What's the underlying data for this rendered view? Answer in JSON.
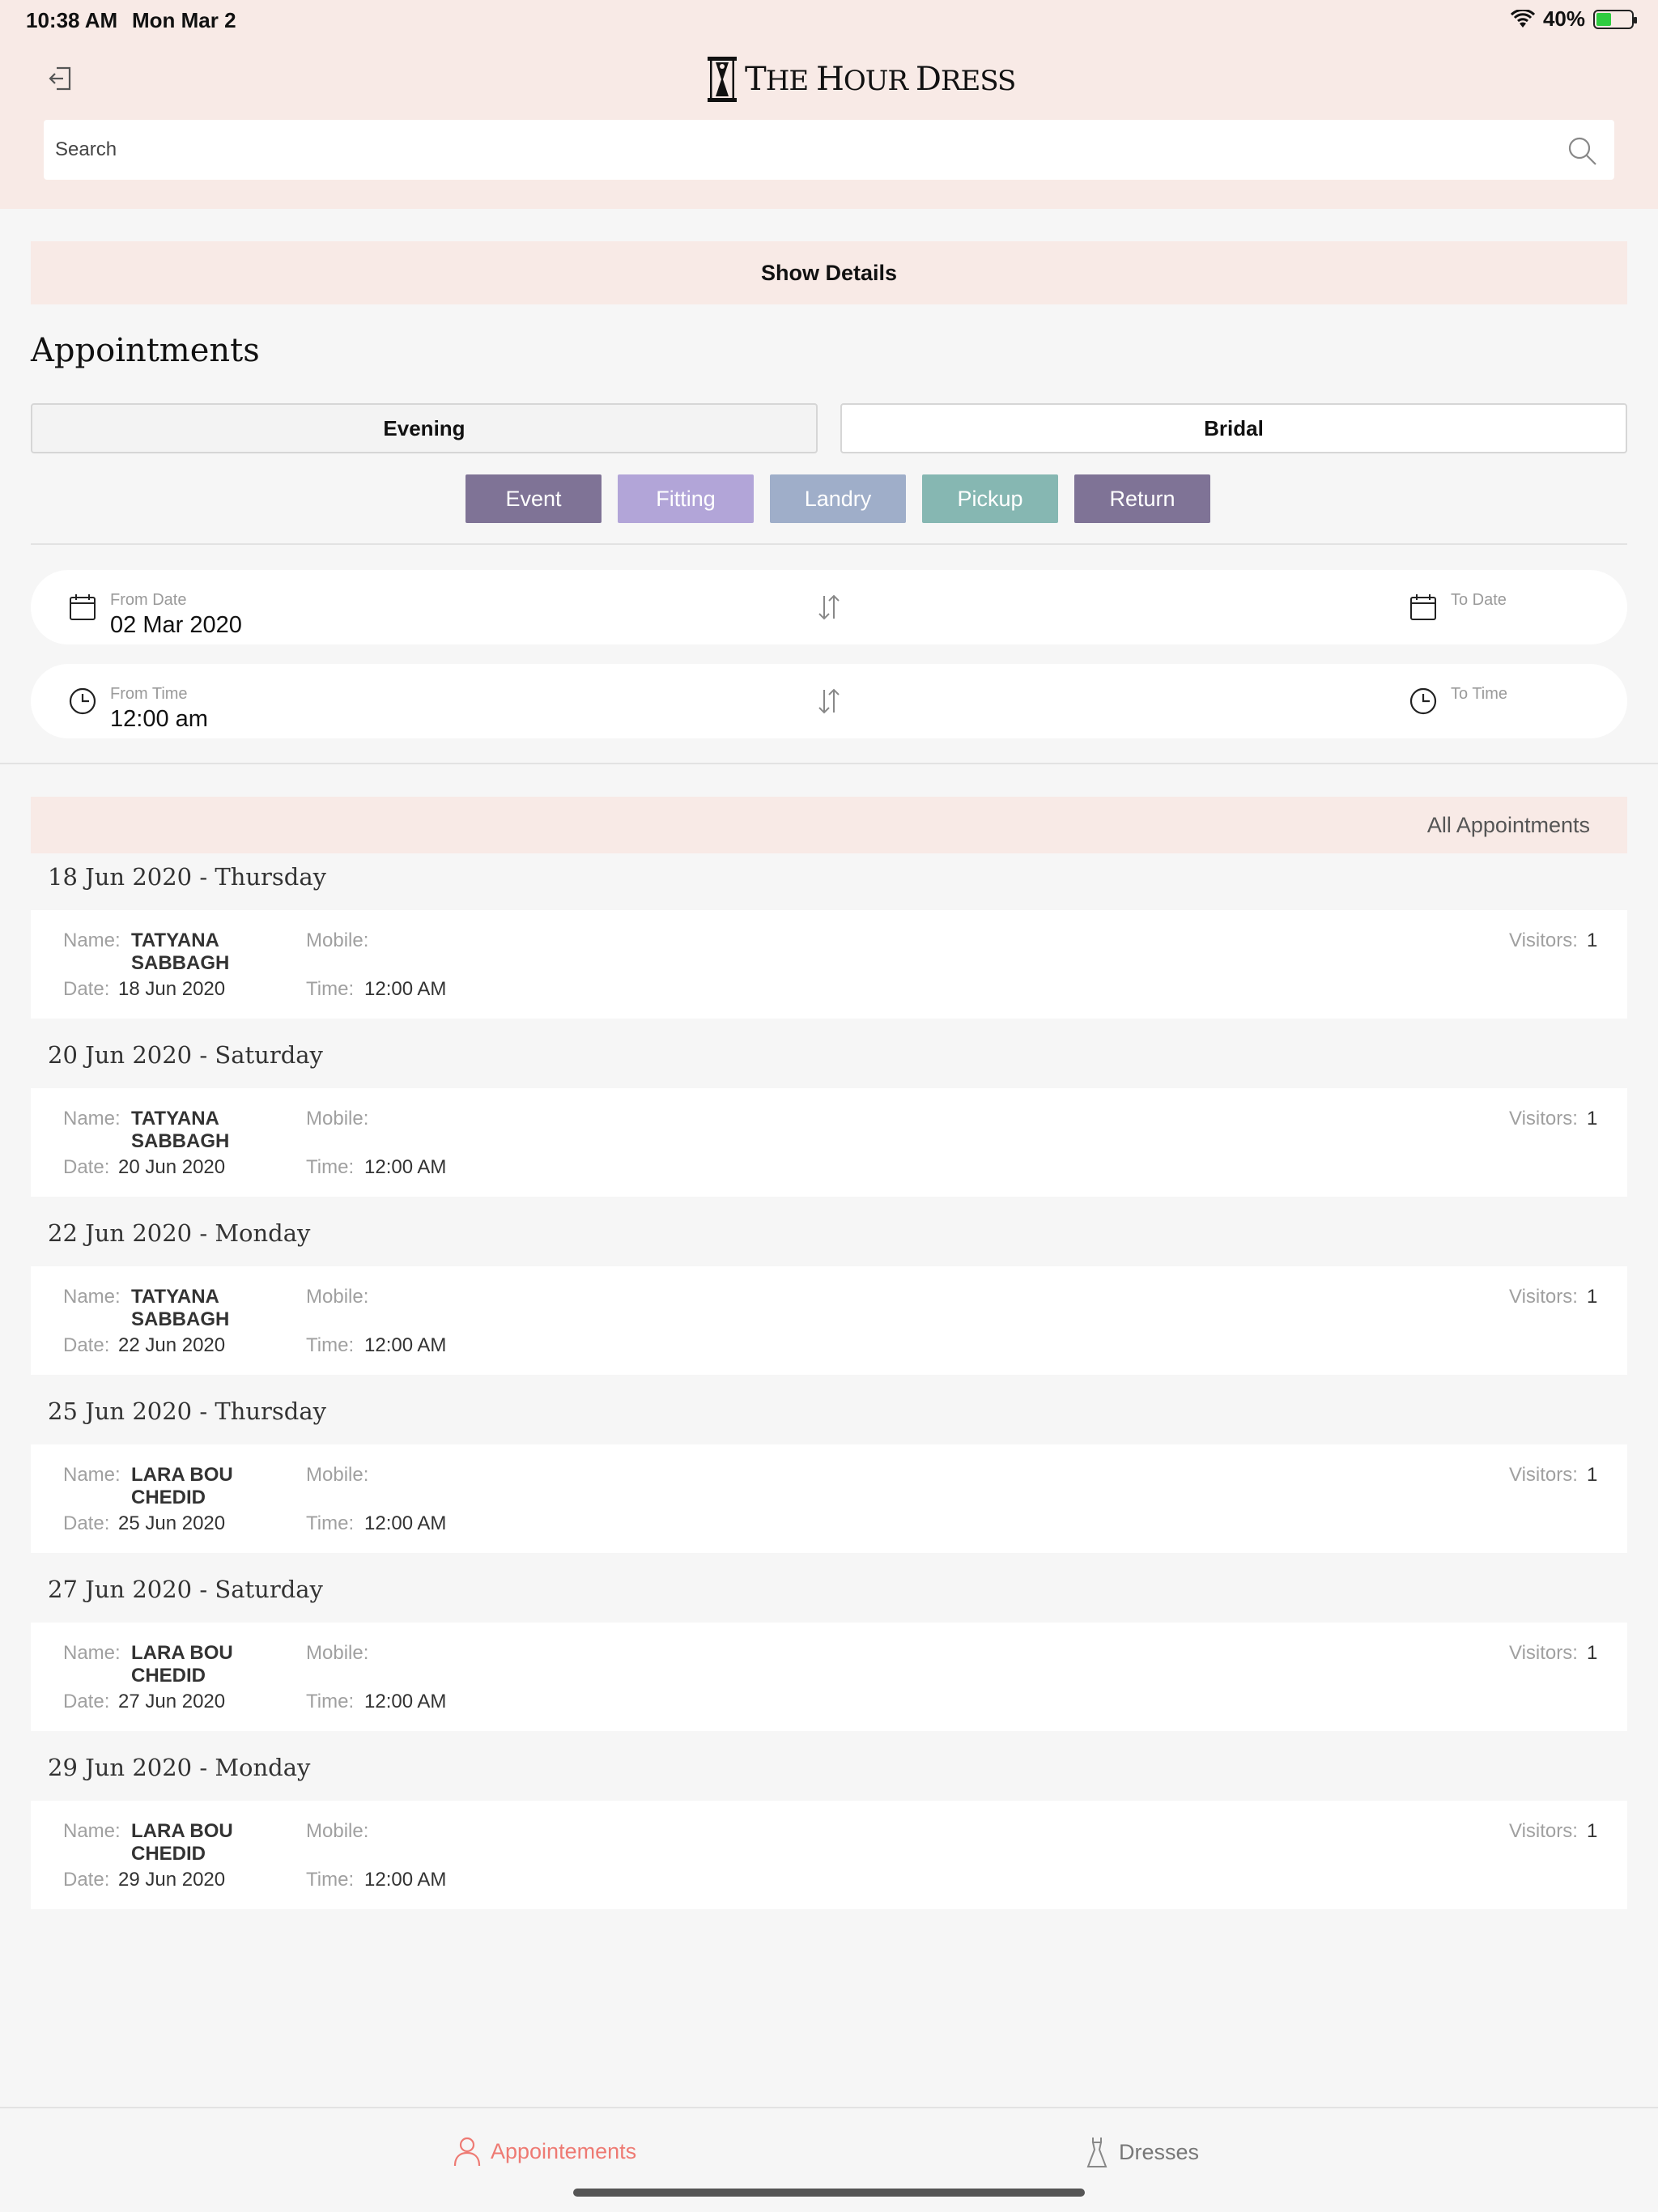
{
  "status_bar": {
    "time": "10:38 AM",
    "date": "Mon Mar 2",
    "battery": "40%"
  },
  "header": {
    "brand_the": "T",
    "brand_he": "HE",
    "brand_hour_h": "H",
    "brand_hour_rest": "OUR",
    "brand_dress_d": "D",
    "brand_dress_rest": "RESS",
    "search_placeholder": "Search"
  },
  "show_details_label": "Show Details",
  "section_title": "Appointments",
  "segments": {
    "evening": "Evening",
    "bridal": "Bridal"
  },
  "types": [
    {
      "label": "Event",
      "color": "#7f7396"
    },
    {
      "label": "Fitting",
      "color": "#b2a5d8"
    },
    {
      "label": "Landry",
      "color": "#9faec9"
    },
    {
      "label": "Pickup",
      "color": "#86b7b2"
    },
    {
      "label": "Return",
      "color": "#7f7396"
    }
  ],
  "date_filter": {
    "from_label": "From Date",
    "from_value": "02 Mar 2020",
    "to_label": "To Date",
    "to_value": ""
  },
  "time_filter": {
    "from_label": "From Time",
    "from_value": "12:00 am",
    "to_label": "To Time",
    "to_value": ""
  },
  "all_appointments_label": "All Appointments",
  "labels": {
    "name": "Name:",
    "mobile": "Mobile:",
    "date": "Date:",
    "time": "Time:",
    "visitors": "Visitors:"
  },
  "groups": [
    {
      "heading": "18 Jun 2020 - Thursday",
      "name_line1": "TATYANA",
      "name_line2": "SABBAGH",
      "mobile": "",
      "date": "18 Jun 2020",
      "time": "12:00 AM",
      "visitors": "1"
    },
    {
      "heading": "20 Jun 2020 - Saturday",
      "name_line1": "TATYANA",
      "name_line2": "SABBAGH",
      "mobile": "",
      "date": "20 Jun 2020",
      "time": "12:00 AM",
      "visitors": "1"
    },
    {
      "heading": "22 Jun 2020 - Monday",
      "name_line1": "TATYANA",
      "name_line2": "SABBAGH",
      "mobile": "",
      "date": "22 Jun 2020",
      "time": "12:00 AM",
      "visitors": "1"
    },
    {
      "heading": "25 Jun 2020 - Thursday",
      "name_line1": "LARA BOU",
      "name_line2": "CHEDID",
      "mobile": "",
      "date": "25 Jun 2020",
      "time": "12:00 AM",
      "visitors": "1"
    },
    {
      "heading": "27 Jun 2020 - Saturday",
      "name_line1": "LARA BOU",
      "name_line2": "CHEDID",
      "mobile": "",
      "date": "27 Jun 2020",
      "time": "12:00 AM",
      "visitors": "1"
    },
    {
      "heading": "29 Jun 2020 - Monday",
      "name_line1": "LARA BOU",
      "name_line2": "CHEDID",
      "mobile": "",
      "date": "29 Jun 2020",
      "time": "12:00 AM",
      "visitors": "1"
    }
  ],
  "tabbar": {
    "appointments": "Appointements",
    "dresses": "Dresses",
    "active_color": "#ee7a73"
  }
}
